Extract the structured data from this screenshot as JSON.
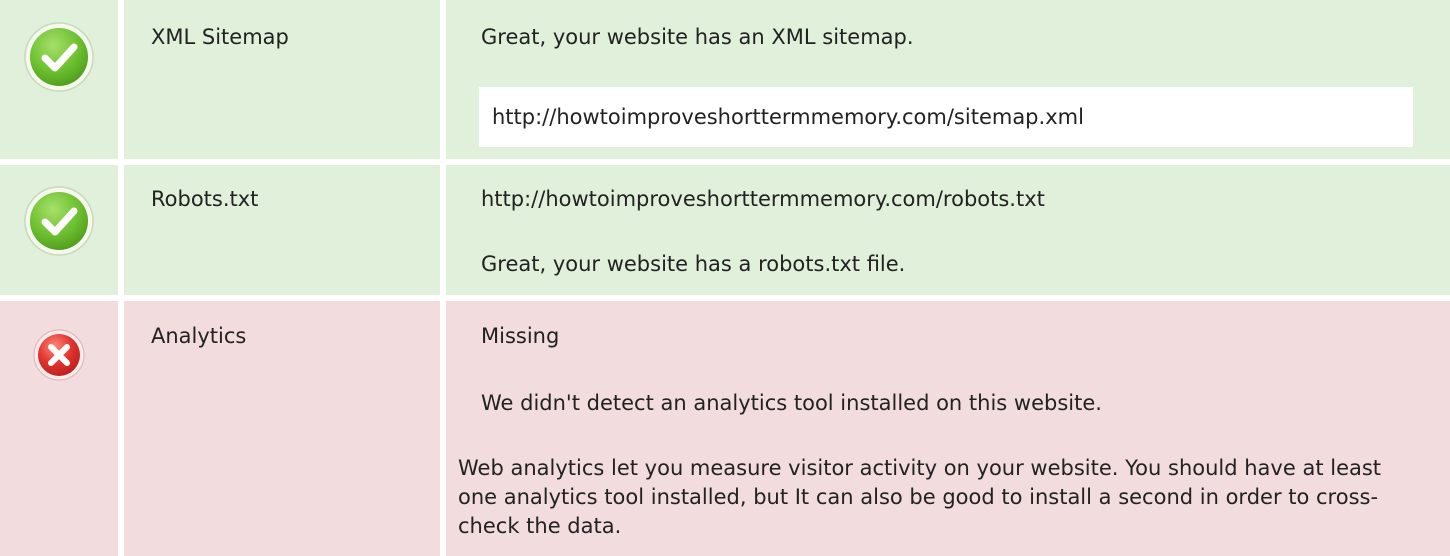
{
  "checks": [
    {
      "name": "XML Sitemap",
      "status": "pass",
      "message": "Great, your website has an XML sitemap.",
      "url": "http://howtoimproveshorttermmemory.com/sitemap.xml"
    },
    {
      "name": "Robots.txt",
      "status": "pass",
      "url": "http://howtoimproveshorttermmemory.com/robots.txt",
      "message": "Great, your website has a robots.txt file."
    },
    {
      "name": "Analytics",
      "status": "fail",
      "result": "Missing",
      "message": "We didn't detect an analytics tool installed on this website.",
      "explanation": "Web analytics let you measure visitor activity on your website. You should have at least one analytics tool installed, but It can also be good to install a second in order to cross-check the data."
    }
  ],
  "icons": {
    "pass": "check-icon",
    "fail": "cross-icon"
  },
  "colors": {
    "pass_bg": "#e0f0da",
    "fail_bg": "#f2dcdd",
    "pass_icon": "#6cbf2f",
    "fail_icon": "#e0322c"
  }
}
